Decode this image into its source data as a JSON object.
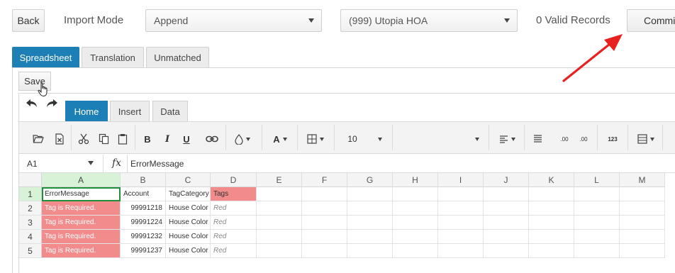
{
  "toolbar": {
    "back_label": "Back",
    "import_mode_label": "Import Mode",
    "import_mode_value": "Append",
    "association_value": "(999) Utopia HOA",
    "valid_records": "0 Valid Records",
    "commit_label": "Commit"
  },
  "tabs": [
    {
      "label": "Spreadsheet",
      "active": true
    },
    {
      "label": "Translation",
      "active": false
    },
    {
      "label": "Unmatched",
      "active": false
    }
  ],
  "save_label": "Save",
  "ribbon": {
    "tabs": [
      {
        "label": "Home",
        "active": true
      },
      {
        "label": "Insert",
        "active": false
      },
      {
        "label": "Data",
        "active": false
      }
    ],
    "bold": "B",
    "italic": "I",
    "underline": "U",
    "font_color": "A",
    "font_size": "10",
    "decimal_increase": ".00",
    "decimal_decrease": ".00",
    "number_format": "123"
  },
  "formula_bar": {
    "name_box": "A1",
    "fx": "fx",
    "value": "ErrorMessage"
  },
  "grid": {
    "columns": [
      "A",
      "B",
      "C",
      "D",
      "E",
      "F",
      "G",
      "H",
      "I",
      "J",
      "K",
      "L",
      "M"
    ],
    "row_numbers": [
      "1",
      "2",
      "3",
      "4",
      "5"
    ],
    "rows": [
      [
        "ErrorMessage",
        "Account",
        "TagCategory",
        "Tags"
      ],
      [
        "Tag is Required.",
        "99991218",
        "House Color",
        "Red"
      ],
      [
        "Tag is Required.",
        "99991224",
        "House Color",
        "Red"
      ],
      [
        "Tag is Required.",
        "99991232",
        "House Color",
        "Red"
      ],
      [
        "Tag is Required.",
        "99991237",
        "House Color",
        "Red"
      ]
    ]
  },
  "colors": {
    "accent": "#1c7fb6",
    "error_fill": "#f28b8b",
    "selection_green": "#d7f2d7",
    "arrow_red": "#e8201f"
  }
}
